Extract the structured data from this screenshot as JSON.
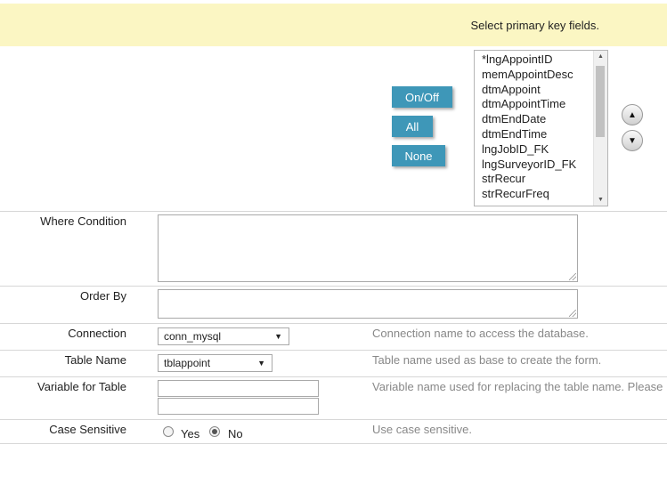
{
  "banner": {
    "text": "Select primary key fields."
  },
  "key_buttons": {
    "onoff": "On/Off",
    "all": "All",
    "none": "None"
  },
  "fields": [
    "*lngAppointID",
    "memAppointDesc",
    "dtmAppoint",
    "dtmAppointTime",
    "dtmEndDate",
    "dtmEndTime",
    "lngJobID_FK",
    "lngSurveyorID_FK",
    "strRecur",
    "strRecurFreq"
  ],
  "icons": {
    "move_up": "▲",
    "move_down": "▼",
    "scroll_up": "▲",
    "scroll_down": "▼",
    "select_caret": "▼"
  },
  "form": {
    "where_label": "Where Condition",
    "where_value": "",
    "order_label": "Order By",
    "order_value": "",
    "connection": {
      "label": "Connection",
      "value": "conn_mysql",
      "help": "Connection name to access the database."
    },
    "table": {
      "label": "Table Name",
      "value": "tblappoint",
      "help": "Table name used as base to create the form."
    },
    "variable": {
      "label": "Variable for Table",
      "help": "Variable name used for replacing the table name. Please"
    },
    "case": {
      "label": "Case Sensitive",
      "yes": "Yes",
      "no": "No",
      "selected": "No",
      "help": "Use case sensitive."
    }
  }
}
